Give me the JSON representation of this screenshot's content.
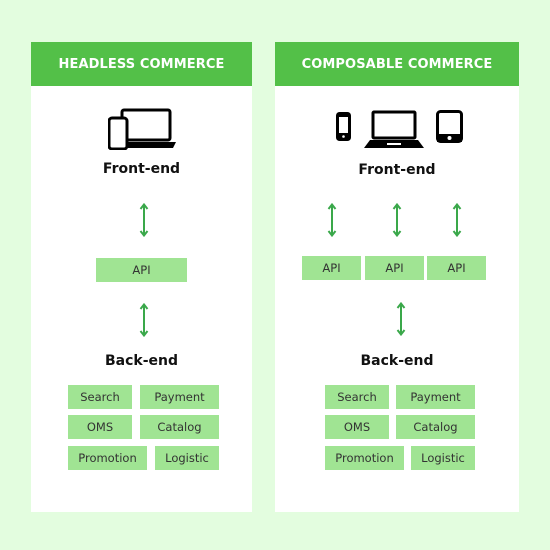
{
  "colors": {
    "background": "#e3fddf",
    "header": "#53c048",
    "box": "#a0e493",
    "arrow": "#3aa84a"
  },
  "headless": {
    "title": "HEADLESS COMMERCE",
    "frontend_label": "Front-end",
    "devices": [
      "phone-icon",
      "laptop-icon"
    ],
    "api_label": "API",
    "backend_label": "Back-end",
    "services": [
      "Search",
      "Payment",
      "OMS",
      "Catalog",
      "Promotion",
      "Logistic"
    ]
  },
  "composable": {
    "title": "COMPOSABLE COMMERCE",
    "frontend_label": "Front-end",
    "devices": [
      "phone-icon",
      "laptop-icon",
      "tablet-icon"
    ],
    "apis": [
      "API",
      "API",
      "API"
    ],
    "backend_label": "Back-end",
    "services": [
      "Search",
      "Payment",
      "OMS",
      "Catalog",
      "Promotion",
      "Logistic"
    ]
  }
}
